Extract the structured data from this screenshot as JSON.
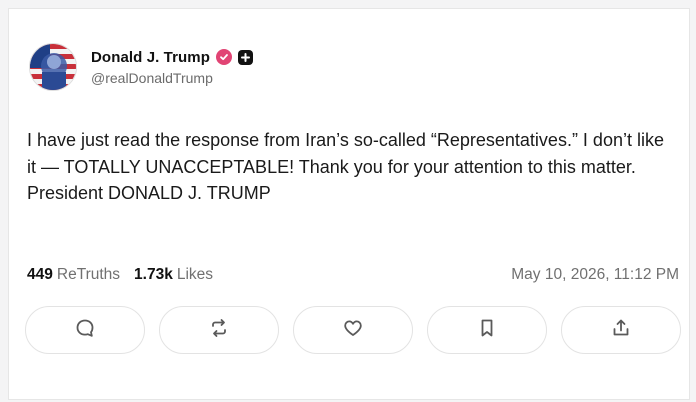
{
  "post": {
    "author": {
      "display_name": "Donald J. Trump",
      "handle": "@realDonaldTrump",
      "verified_badge_icon": "verified-check-icon",
      "plus_badge_icon": "plus-badge-icon",
      "verified_color": "#e14474"
    },
    "text": "I have just read the response from Iran’s so-called “Representatives.” I don’t like it — TOTALLY UNACCEPTABLE! Thank you for your attention to this matter. President DONALD J. TRUMP",
    "stats": {
      "retruths_count": "449",
      "retruths_label": "ReTruths",
      "likes_count": "1.73k",
      "likes_label": "Likes"
    },
    "timestamp": "May 10, 2026, 11:12 PM"
  },
  "actions": [
    {
      "icon": "reply-icon"
    },
    {
      "icon": "retruth-icon"
    },
    {
      "icon": "heart-icon"
    },
    {
      "icon": "bookmark-icon"
    },
    {
      "icon": "share-icon"
    }
  ]
}
